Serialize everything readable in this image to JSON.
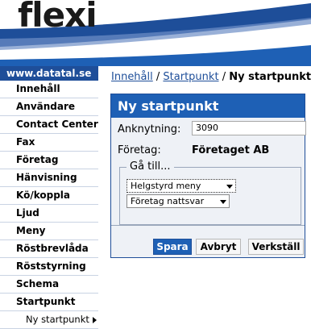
{
  "brand": {
    "logo_text": "flexi",
    "site_label": "www.datatal.se"
  },
  "sidebar": {
    "items": [
      {
        "label": "Innehåll"
      },
      {
        "label": "Användare"
      },
      {
        "label": "Contact Center"
      },
      {
        "label": "Fax"
      },
      {
        "label": "Företag"
      },
      {
        "label": "Hänvisning"
      },
      {
        "label": "Kö/koppla"
      },
      {
        "label": "Ljud"
      },
      {
        "label": "Meny"
      },
      {
        "label": "Röstbrevlåda"
      },
      {
        "label": "Röststyrning"
      },
      {
        "label": "Schema"
      },
      {
        "label": "Startpunkt"
      }
    ],
    "subitem": {
      "label": "Ny startpunkt",
      "icon": "arrow-right-icon"
    }
  },
  "breadcrumb": {
    "link1": "Innehåll",
    "sep1": "/",
    "link2": "Startpunkt",
    "sep2": "/",
    "current": "Ny startpunkt"
  },
  "panel": {
    "title": "Ny startpunkt",
    "connection_label": "Anknytning:",
    "connection_value": "3090",
    "company_label": "Företag:",
    "company_value": "Företaget AB",
    "goto_legend": "Gå till...",
    "goto_type": "Helgstyrd meny",
    "goto_target": "Företag nattsvar"
  },
  "actions": {
    "save": "Spara",
    "cancel": "Avbryt",
    "execute": "Verkställ"
  },
  "colors": {
    "brand_blue": "#1e4e99",
    "panel_title_blue": "#1e60b5",
    "link_blue": "#1e4e99"
  }
}
